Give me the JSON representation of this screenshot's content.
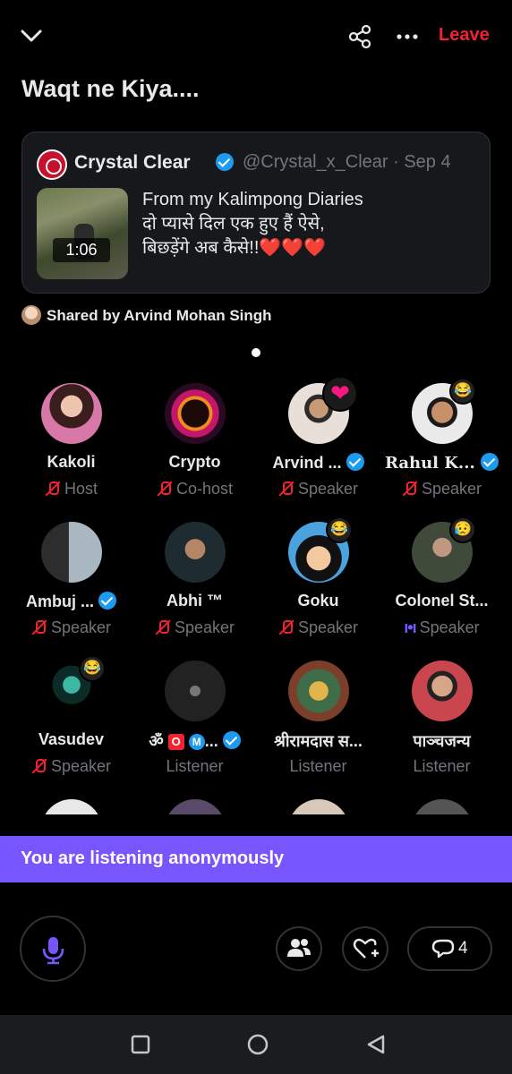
{
  "header": {
    "back_icon": "chevron-down-icon",
    "share_icon": "share-icon",
    "more_icon": "more-horizontal-icon",
    "leave_label": "Leave",
    "leave_color": "#f4212e"
  },
  "space": {
    "title": "Waqt ne Kiya...."
  },
  "pinned_post": {
    "author_name": "Crystal Clear",
    "author_handle": "@Crystal_x_Clear · Sep 4",
    "video_duration": "1:06",
    "text_lines": [
      "From my Kalimpong Diaries",
      "दो प्यासे दिल एक हुए हैं ऐसे,",
      "बिछड़ेंगे अब कैसे!!❤️❤️❤️"
    ]
  },
  "shared_by": "Shared by Arvind Mohan Singh",
  "participants": [
    {
      "name": "Kakoli",
      "role": "Host",
      "mic": "muted"
    },
    {
      "name": "Crypto",
      "role": "Co-host",
      "mic": "muted"
    },
    {
      "name": "Arvind ...",
      "role": "Speaker",
      "mic": "muted",
      "verified": true,
      "reaction": "❤"
    },
    {
      "name": "Rahul K...",
      "role": "Speaker",
      "mic": "muted",
      "verified": true,
      "reaction": "😂"
    },
    {
      "name": "Ambuj ...",
      "role": "Speaker",
      "mic": "muted",
      "verified": true
    },
    {
      "name": "Abhi ™",
      "role": "Speaker",
      "mic": "muted"
    },
    {
      "name": "Goku",
      "role": "Speaker",
      "mic": "muted",
      "reaction": "😂"
    },
    {
      "name": "Colonel St...",
      "role": "Speaker",
      "mic": "speaking",
      "reaction": "😥"
    },
    {
      "name": "Vasudev",
      "role": "Speaker",
      "mic": "muted",
      "reaction": "😂"
    },
    {
      "name": "ॐ",
      "name_badges": [
        "O",
        "M",
        "..."
      ],
      "role": "Listener",
      "verified": true
    },
    {
      "name": "श्रीरामदास स...",
      "role": "Listener"
    },
    {
      "name": "पाञ्चजन्य",
      "role": "Listener"
    }
  ],
  "speaking_wave": "ı•ı",
  "banner": {
    "text": "You are listening anonymously",
    "color": "#7856ff"
  },
  "bottom_bar": {
    "mic_icon": "microphone-icon",
    "people_icon": "people-icon",
    "react_icon": "heart-plus-icon",
    "comment_icon": "comment-icon",
    "comment_count": "4",
    "accent": "#7856ff"
  },
  "system_nav": {
    "recents_icon": "square-icon",
    "home_icon": "circle-icon",
    "back_icon": "triangle-back-icon"
  }
}
